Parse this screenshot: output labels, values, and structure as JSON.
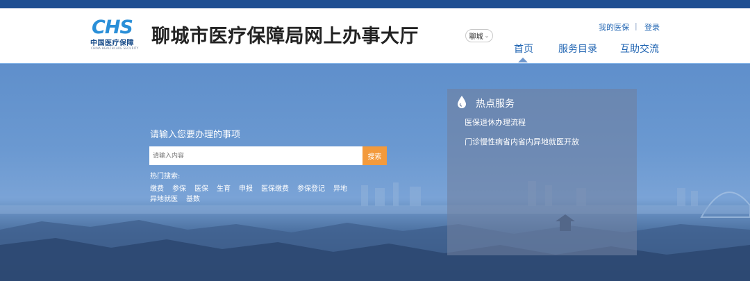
{
  "header": {
    "logo": {
      "mark": "CHS",
      "name_cn": "中国医疗保障",
      "name_en": "CHINA HEALTHCARE SECURITY"
    },
    "site_title": "聊城市医疗保障局网上办事大厅",
    "city_select": "聊城",
    "top_links": {
      "my_insurance": "我的医保",
      "separator": "|",
      "login": "登录"
    },
    "nav": {
      "home": "首页",
      "service_catalog": "服务目录",
      "interaction": "互助交流"
    }
  },
  "search": {
    "label": "请输入您要办理的事项",
    "placeholder": "请输入内容",
    "button": "搜索",
    "hot_label": "热门搜索:",
    "hot_tags": [
      "缴费",
      "参保",
      "医保",
      "生育",
      "申报",
      "医保缴费",
      "参保登记",
      "异地",
      "异地就医",
      "基数"
    ]
  },
  "hot_services": {
    "title": "热点服务",
    "items": [
      "医保退休办理流程",
      "门诊慢性病省内省内异地就医开放"
    ]
  },
  "colors": {
    "brand_blue": "#1f4f92",
    "link_blue": "#2266b3",
    "search_button": "#f39a3c",
    "logo_blue": "#2a8fd8"
  },
  "icons": {
    "city_chevron": "chevron-down-icon",
    "hot_services": "water-drop-icon"
  }
}
